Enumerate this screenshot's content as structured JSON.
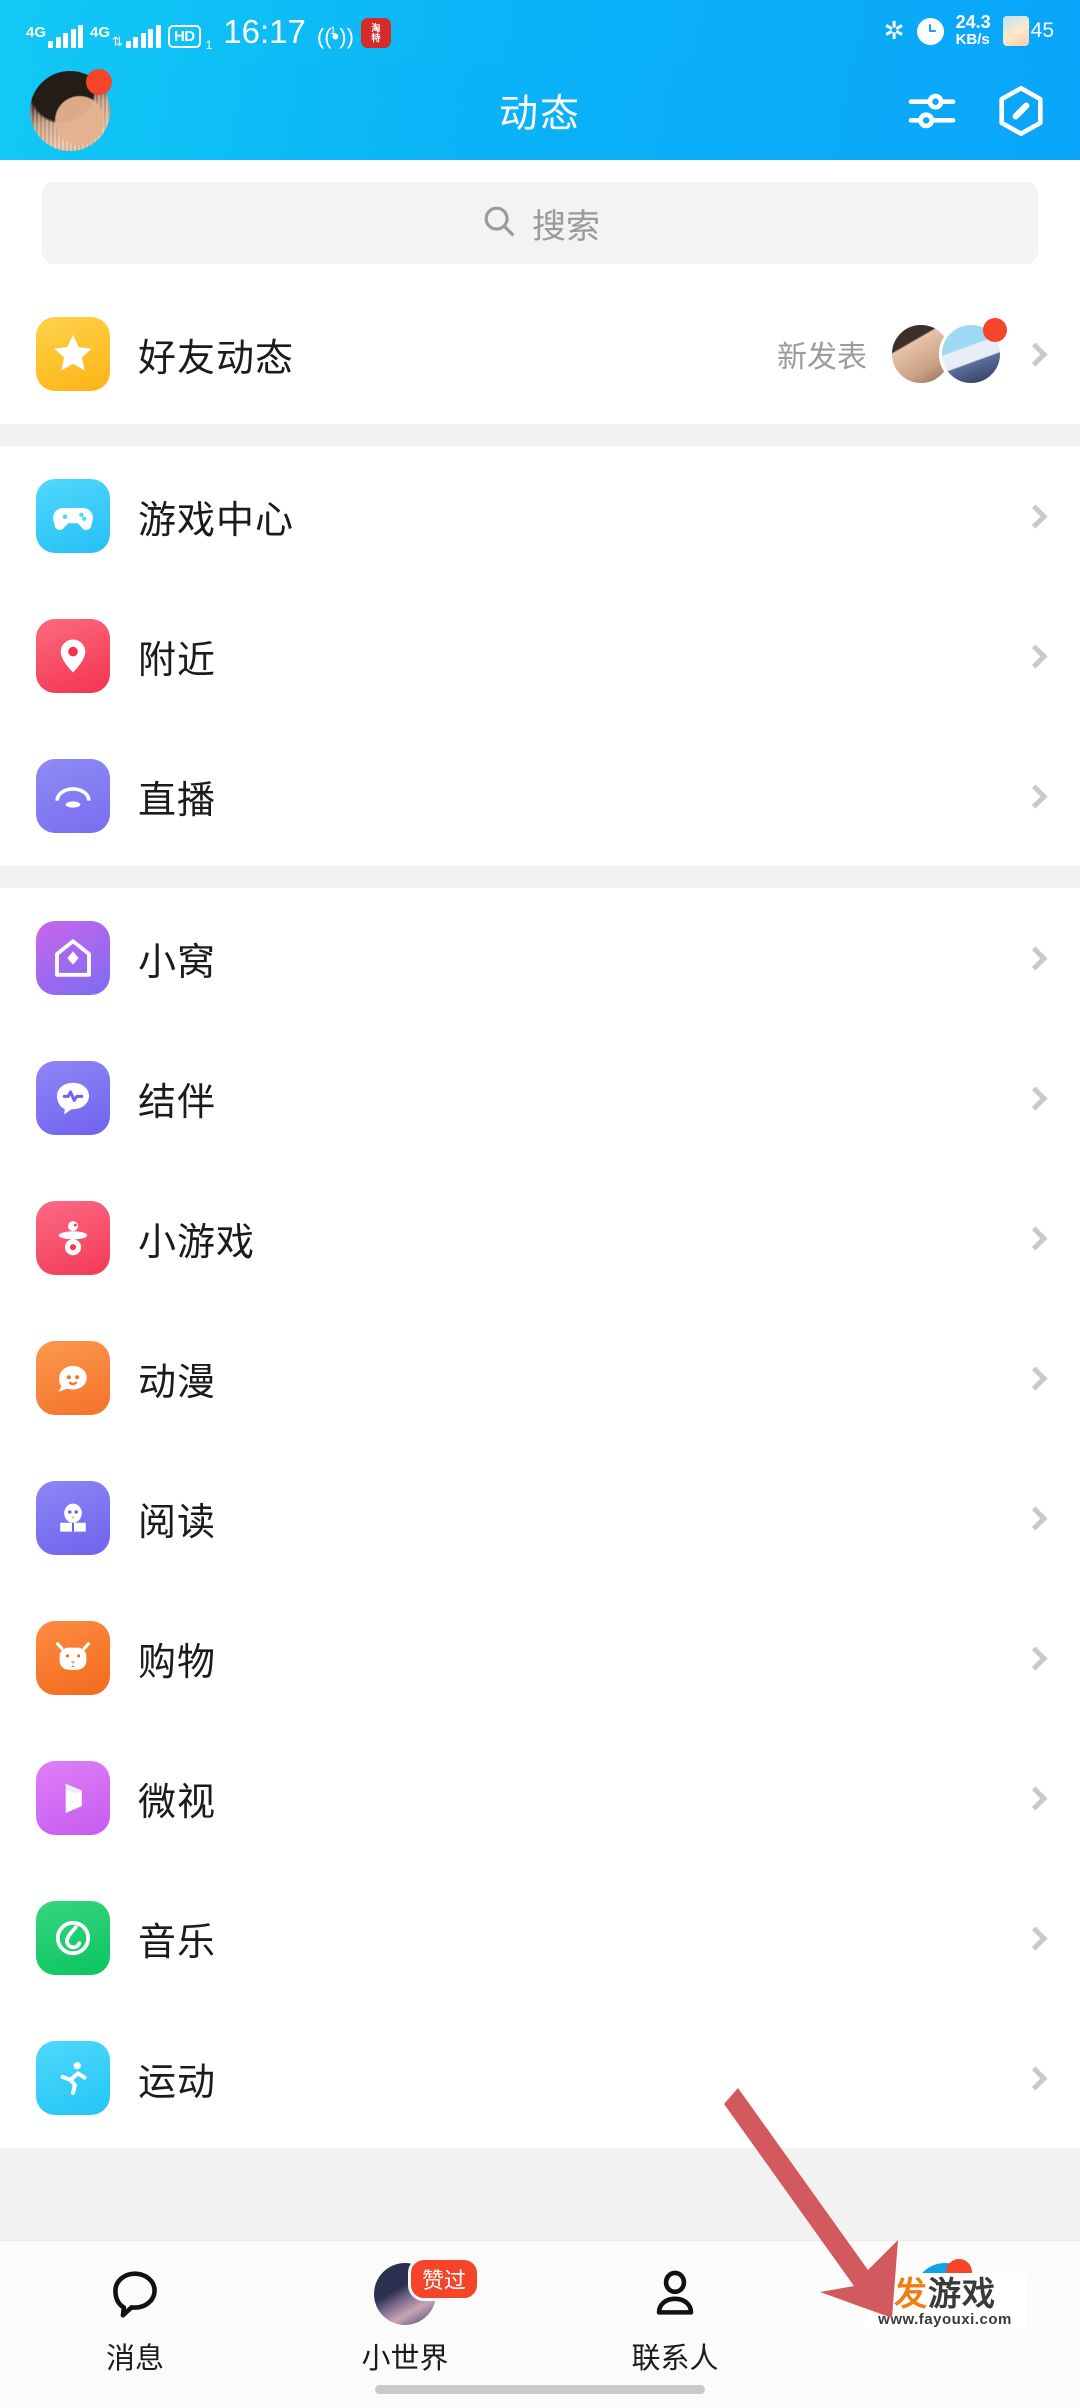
{
  "status_bar": {
    "network_1": "4G",
    "network_2": "4G",
    "hd_label": "HD",
    "hd_sub": "1",
    "time": "16:17",
    "hotspot_count": "1",
    "app_badge_top": "淘",
    "app_badge_bottom": "特",
    "bluetooth_icon": "bluetooth-icon",
    "alarm_icon": "alarm-icon",
    "net_speed_value": "24.3",
    "net_speed_unit": "KB/s",
    "battery_level": "45"
  },
  "header": {
    "title": "动态",
    "avatar_name": "user-avatar",
    "avatar_badge": "unread-dot",
    "filter_icon": "sliders-icon",
    "qq_show_icon": "hexagon-pen-icon"
  },
  "search": {
    "placeholder": "搜索",
    "icon": "search-icon"
  },
  "featured": {
    "label": "好友动态",
    "sub_label": "新发表",
    "icon": "qzone-star-icon"
  },
  "groups": [
    {
      "items": [
        {
          "label": "游戏中心",
          "icon": "gamepad-icon"
        },
        {
          "label": "附近",
          "icon": "location-pin-icon"
        },
        {
          "label": "直播",
          "icon": "live-stream-icon"
        }
      ]
    },
    {
      "items": [
        {
          "label": "小窝",
          "icon": "house-icon"
        },
        {
          "label": "结伴",
          "icon": "companion-chat-icon"
        },
        {
          "label": "小游戏",
          "icon": "mini-game-icon"
        },
        {
          "label": "动漫",
          "icon": "anime-icon"
        },
        {
          "label": "阅读",
          "icon": "reading-penguin-icon"
        },
        {
          "label": "购物",
          "icon": "shopping-cow-icon"
        },
        {
          "label": "微视",
          "icon": "weishi-video-icon"
        },
        {
          "label": "音乐",
          "icon": "music-note-icon"
        },
        {
          "label": "运动",
          "icon": "sport-runner-icon"
        }
      ]
    }
  ],
  "chevron_icon": "chevron-right-icon",
  "annotation": {
    "arrow_icon": "red-arrow-icon",
    "arrow_color": "#d25a5e"
  },
  "tabbar": {
    "tabs": [
      {
        "label": "消息",
        "icon": "chat-bubble-icon",
        "active": "false",
        "badge": ""
      },
      {
        "label": "小世界",
        "icon": "world-avatar-icon",
        "active": "false",
        "badge": "赞过"
      },
      {
        "label": "联系人",
        "icon": "contacts-person-icon",
        "active": "false",
        "badge": ""
      },
      {
        "label": "",
        "icon": "dynamic-star-icon",
        "active": "true",
        "badge": "dot"
      }
    ]
  },
  "watermark": {
    "brand_first": "发",
    "brand_rest": "游戏",
    "url": "www.fayouxi.com"
  }
}
